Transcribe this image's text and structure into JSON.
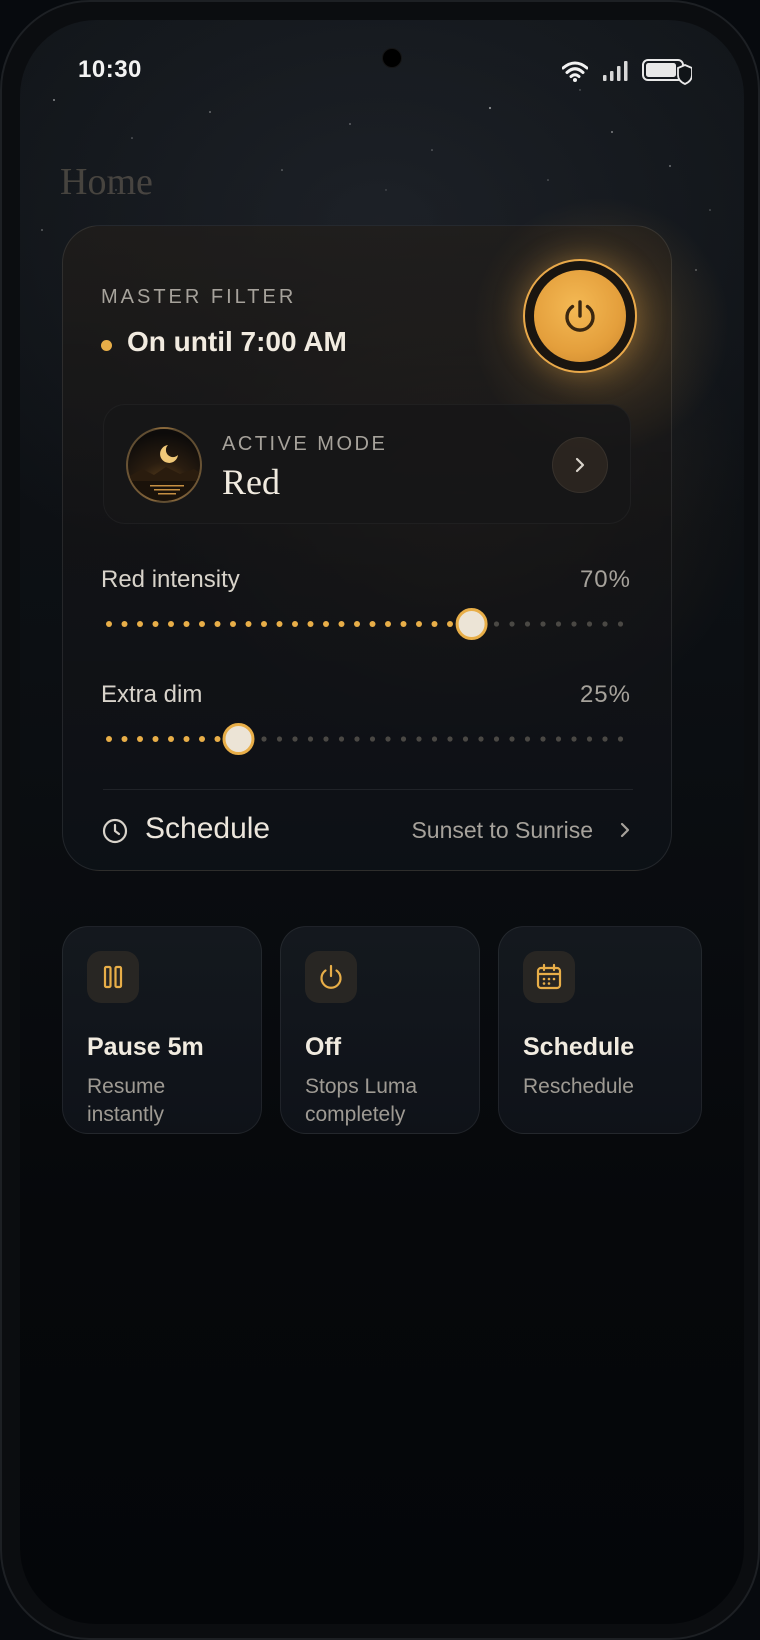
{
  "status_bar": {
    "time": "10:30"
  },
  "page": {
    "title": "Home"
  },
  "master_filter": {
    "label": "MASTER FILTER",
    "status": "On until 7:00 AM",
    "power_on": true
  },
  "active_mode": {
    "label": "ACTIVE MODE",
    "value": "Red"
  },
  "sliders": [
    {
      "label": "Red intensity",
      "value_text": "70%",
      "value": 0.7
    },
    {
      "label": "Extra dim",
      "value_text": "25%",
      "value": 0.25
    }
  ],
  "schedule": {
    "label": "Schedule",
    "value": "Sunset to Sunrise"
  },
  "quick_actions": [
    {
      "icon": "pause-icon",
      "title": "Pause 5m",
      "subtitle": "Resume instantly"
    },
    {
      "icon": "power-icon",
      "title": "Off",
      "subtitle": "Stops Luma completely"
    },
    {
      "icon": "calendar-icon",
      "title": "Schedule",
      "subtitle": "Reschedule"
    }
  ],
  "colors": {
    "accent": "#e8ae48",
    "text_primary": "#f1ebe0",
    "text_muted": "#a6a29b",
    "inactive_dot": "#4a4844"
  }
}
